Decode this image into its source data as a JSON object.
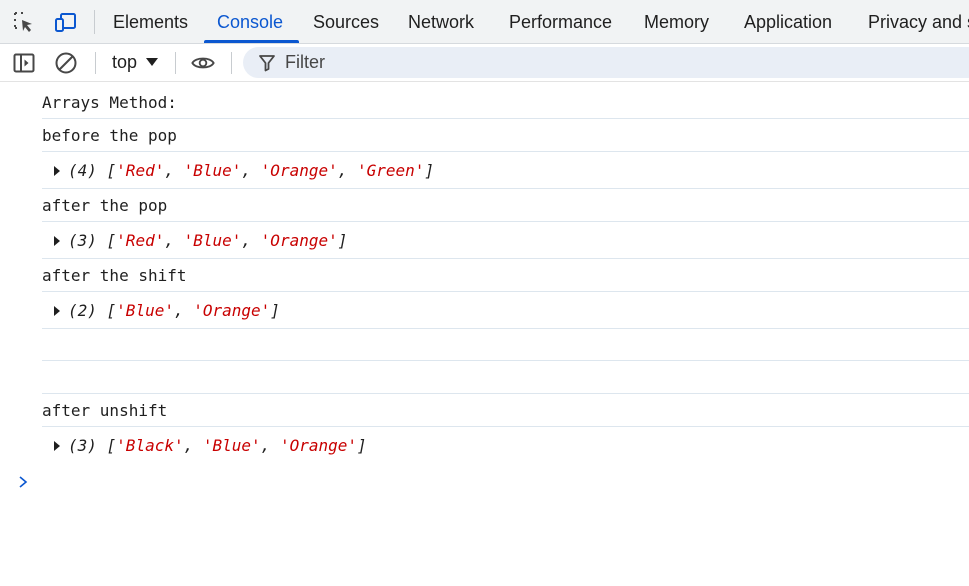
{
  "tabs": [
    {
      "label": "Elements"
    },
    {
      "label": "Console"
    },
    {
      "label": "Sources"
    },
    {
      "label": "Network"
    },
    {
      "label": "Performance"
    },
    {
      "label": "Memory"
    },
    {
      "label": "Application"
    },
    {
      "label": "Privacy and s"
    }
  ],
  "active_tab": "Console",
  "toolbar": {
    "context": "top",
    "filter_placeholder": "Filter"
  },
  "console": {
    "messages": [
      {
        "text": "Arrays Method:"
      },
      {
        "text": "before the pop"
      },
      {
        "count": "(4)",
        "items": [
          "'Red'",
          "'Blue'",
          "'Orange'",
          "'Green'"
        ]
      },
      {
        "text": "after the pop"
      },
      {
        "count": "(3)",
        "items": [
          "'Red'",
          "'Blue'",
          "'Orange'"
        ]
      },
      {
        "text": "after the shift"
      },
      {
        "count": "(2)",
        "items": [
          "'Blue'",
          "'Orange'"
        ]
      },
      {
        "text": ""
      },
      {
        "text": ""
      },
      {
        "text": "after unshift"
      },
      {
        "count": "(3)",
        "items": [
          "'Black'",
          "'Blue'",
          "'Orange'"
        ]
      }
    ]
  },
  "colors": {
    "accent": "#0b57d0",
    "string": "#c80000",
    "filter_bg": "#e9eef6"
  }
}
